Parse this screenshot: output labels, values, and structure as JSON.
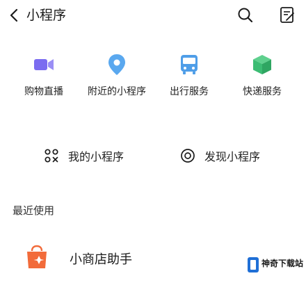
{
  "header": {
    "title": "小程序",
    "back_icon": "chevron-left-icon",
    "search_icon": "search-icon",
    "manage_icon": "clipboard-edit-icon"
  },
  "quick_access": [
    {
      "label": "购物直播",
      "icon": "video-camera-icon",
      "color": "#7b6cf0"
    },
    {
      "label": "附近的小程序",
      "icon": "location-pin-icon",
      "color": "#5aa8ef"
    },
    {
      "label": "出行服务",
      "icon": "bus-icon",
      "color": "#4f9ee8"
    },
    {
      "label": "快递服务",
      "icon": "package-box-icon",
      "color": "#3cbc73"
    }
  ],
  "nav": {
    "my_label": "我的小程序",
    "discover_label": "发现小程序"
  },
  "recent": {
    "section_title": "最近使用",
    "items": [
      {
        "label": "小商店助手",
        "icon": "shopping-bag-icon",
        "color": "#f26b3a"
      }
    ]
  },
  "watermark": {
    "text": "神奇下载站"
  }
}
